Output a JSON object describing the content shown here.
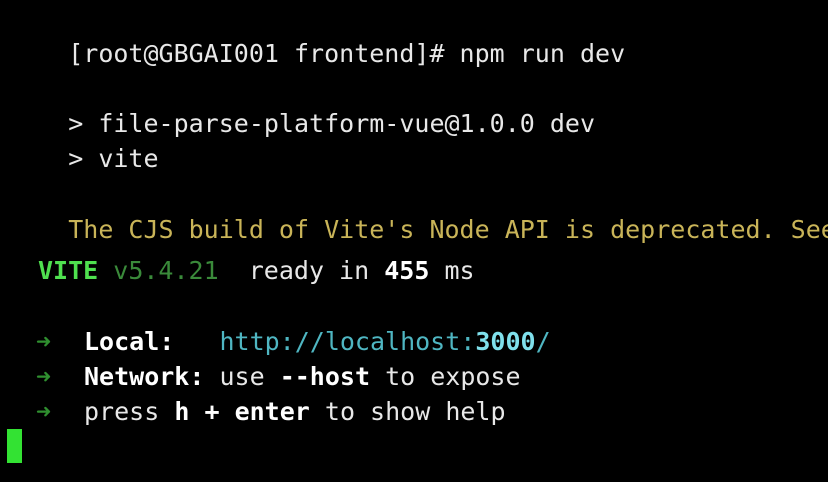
{
  "prompt": {
    "text": "[root@GBGAI001 frontend]# npm run dev"
  },
  "script_lines": [
    "> file-parse-platform-vue@1.0.0 dev",
    "> vite"
  ],
  "warning": {
    "text": "The CJS build of Vite's Node API is deprecated. See"
  },
  "vite_status": {
    "name": "VITE",
    "version": "v5.4.21",
    "ready_prefix": "ready in",
    "ready_time": "455",
    "ready_unit": "ms"
  },
  "server_info": {
    "arrow": "➜",
    "local_label": "Local:",
    "local_url_prefix": "http://localhost:",
    "local_port": "3000",
    "local_url_suffix": "/",
    "network_label": "Network:",
    "network_use": "use",
    "network_flag": "--host",
    "network_suffix": "to expose",
    "help_prefix": "press",
    "help_key_h": "h",
    "help_plus": "+",
    "help_key_enter": "enter",
    "help_suffix": "to show help"
  },
  "colors": {
    "background": "#000000",
    "text": "#e8e8e8",
    "warning": "#c9b458",
    "vite_green": "#4fe04f",
    "url_cyan": "#4fb6c2",
    "cursor": "#33e233"
  }
}
